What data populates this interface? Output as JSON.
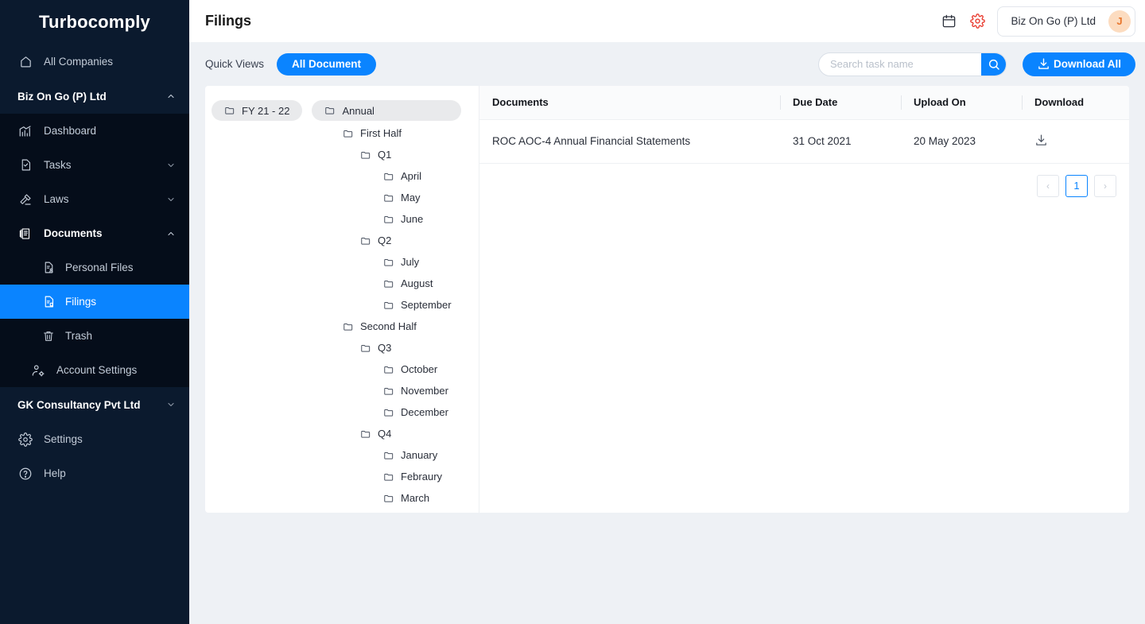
{
  "brand": {
    "name": "Turbocomply"
  },
  "sidebar": {
    "all_companies": {
      "label": "All Companies",
      "icon": "home-icon"
    },
    "company_group": {
      "label": "Biz On Go (P) Ltd",
      "expanded_icon": "chevron-up-icon",
      "items": [
        {
          "label": "Dashboard",
          "icon": "chart-icon",
          "chevron": ""
        },
        {
          "label": "Tasks",
          "icon": "task-document-icon",
          "chevron": "chevron-down-icon"
        },
        {
          "label": "Laws",
          "icon": "gavel-icon",
          "chevron": "chevron-down-icon"
        },
        {
          "label": "Documents",
          "icon": "documents-stack-icon",
          "chevron": "chevron-up-icon"
        }
      ],
      "documents_children": [
        {
          "label": "Personal Files",
          "icon": "personal-file-icon",
          "active": false
        },
        {
          "label": "Filings",
          "icon": "filing-document-icon",
          "active": true
        },
        {
          "label": "Trash",
          "icon": "trash-icon",
          "active": false
        }
      ],
      "account_settings": {
        "label": "Account Settings",
        "icon": "account-settings-icon"
      }
    },
    "second_company": {
      "label": "GK Consultancy Pvt Ltd",
      "chevron": "chevron-down-icon"
    },
    "footer_items": [
      {
        "label": "Settings",
        "icon": "gear-icon"
      },
      {
        "label": "Help",
        "icon": "help-circle-icon"
      }
    ],
    "colors": {
      "background": "#0b1a2e",
      "group_background": "#050d1a",
      "active": "#0a84ff"
    }
  },
  "header": {
    "title": "Filings",
    "calendar_icon": "calendar-icon",
    "settings_icon": "gear-icon",
    "settings_icon_color": "#e8382c",
    "company": {
      "name": "Biz On Go (P) Ltd",
      "avatar_initial": "J",
      "avatar_color": "#fcdcc0"
    }
  },
  "toolbar": {
    "quick_views_label": "Quick Views",
    "all_document_label": "All Document",
    "search": {
      "placeholder": "Search task name",
      "value": "",
      "icon": "search-icon"
    },
    "download_all_label": "Download All",
    "download_all_icon": "download-icon",
    "accent": "#0a84ff"
  },
  "breadcrumb": {
    "chips": [
      {
        "label": "FY 21 - 22",
        "icon": "folder-icon"
      },
      {
        "label": "Annual",
        "icon": "folder-icon"
      }
    ]
  },
  "tree": [
    {
      "label": "First Half",
      "depth": 1,
      "icon": "folder-icon"
    },
    {
      "label": "Q1",
      "depth": 2,
      "icon": "folder-icon"
    },
    {
      "label": "April",
      "depth": 3,
      "icon": "folder-icon"
    },
    {
      "label": "May",
      "depth": 3,
      "icon": "folder-icon"
    },
    {
      "label": "June",
      "depth": 3,
      "icon": "folder-icon"
    },
    {
      "label": "Q2",
      "depth": 2,
      "icon": "folder-icon"
    },
    {
      "label": "July",
      "depth": 3,
      "icon": "folder-icon"
    },
    {
      "label": "August",
      "depth": 3,
      "icon": "folder-icon"
    },
    {
      "label": "September",
      "depth": 3,
      "icon": "folder-icon"
    },
    {
      "label": "Second Half",
      "depth": 1,
      "icon": "folder-icon"
    },
    {
      "label": "Q3",
      "depth": 2,
      "icon": "folder-icon"
    },
    {
      "label": "October",
      "depth": 3,
      "icon": "folder-icon"
    },
    {
      "label": "November",
      "depth": 3,
      "icon": "folder-icon"
    },
    {
      "label": "December",
      "depth": 3,
      "icon": "folder-icon"
    },
    {
      "label": "Q4",
      "depth": 2,
      "icon": "folder-icon"
    },
    {
      "label": "January",
      "depth": 3,
      "icon": "folder-icon"
    },
    {
      "label": "Febraury",
      "depth": 3,
      "icon": "folder-icon"
    },
    {
      "label": "March",
      "depth": 3,
      "icon": "folder-icon"
    }
  ],
  "table": {
    "columns": [
      "Documents",
      "Due Date",
      "Upload On",
      "Download"
    ],
    "rows": [
      {
        "document": "ROC AOC-4 Annual Financial Statements",
        "due_date": "31 Oct 2021",
        "upload_on": "20 May 2023",
        "download_icon": "download-icon"
      }
    ]
  },
  "pagination": {
    "prev_label": "‹",
    "next_label": "›",
    "pages": [
      "1"
    ],
    "current": "1"
  }
}
